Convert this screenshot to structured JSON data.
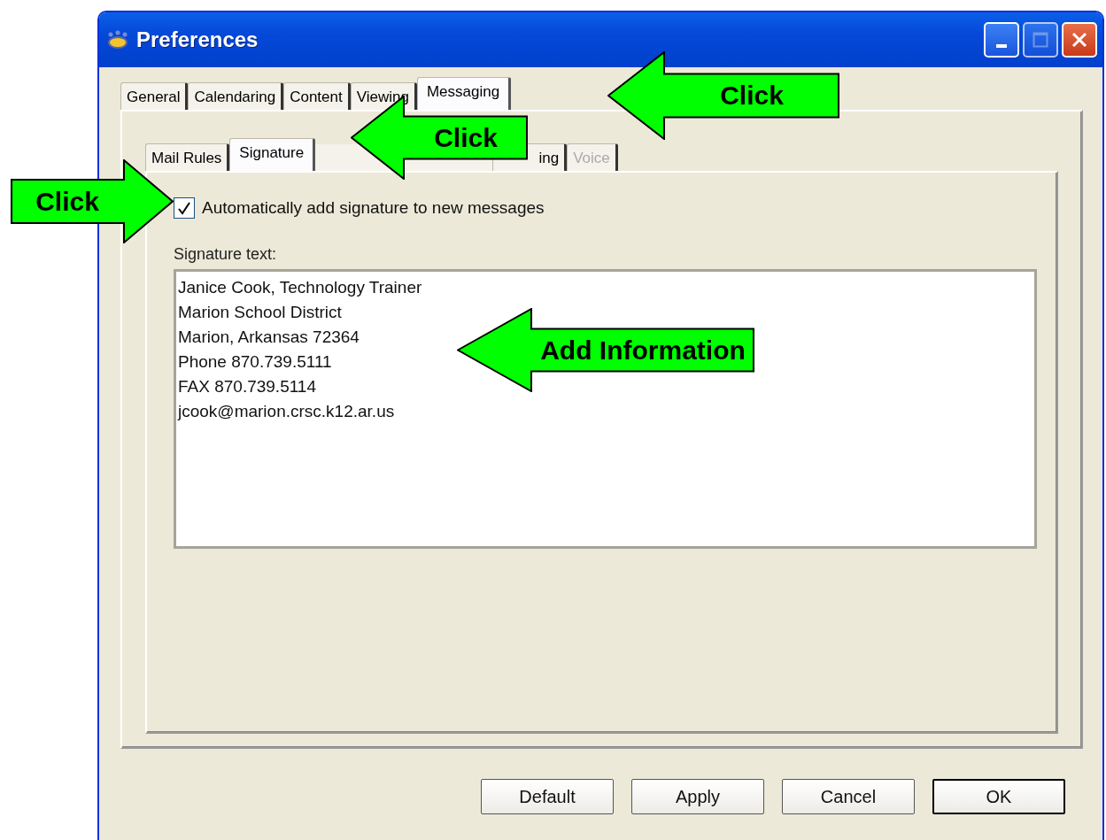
{
  "window": {
    "title": "Preferences"
  },
  "tabs": [
    {
      "label": "General",
      "selected": false
    },
    {
      "label": "Calendaring",
      "selected": false
    },
    {
      "label": "Content",
      "selected": false
    },
    {
      "label": "Viewing",
      "selected": false
    },
    {
      "label": "Messaging",
      "selected": true
    }
  ],
  "subtabs": [
    {
      "label": "Mail Rules",
      "selected": false,
      "disabled": false
    },
    {
      "label": "Signature",
      "selected": true,
      "disabled": false
    },
    {
      "label": "ing",
      "selected": false,
      "disabled": false
    },
    {
      "label": "Voice",
      "selected": false,
      "disabled": true
    }
  ],
  "auto_signature": {
    "label": "Automatically add signature to new messages",
    "checked": true
  },
  "signature": {
    "label": "Signature text:",
    "value": "Janice Cook, Technology Trainer\nMarion School District\nMarion, Arkansas 72364\nPhone 870.739.5111\nFAX 870.739.5114\njcook@marion.crsc.k12.ar.us"
  },
  "buttons": [
    {
      "label": "Default",
      "default": false
    },
    {
      "label": "Apply",
      "default": false
    },
    {
      "label": "Cancel",
      "default": false
    },
    {
      "label": "OK",
      "default": true
    }
  ],
  "callouts": [
    {
      "text": "Click",
      "kind": "left"
    },
    {
      "text": "Click",
      "kind": "left"
    },
    {
      "text": "Click",
      "kind": "right"
    },
    {
      "text": "Add Information",
      "kind": "left"
    }
  ]
}
